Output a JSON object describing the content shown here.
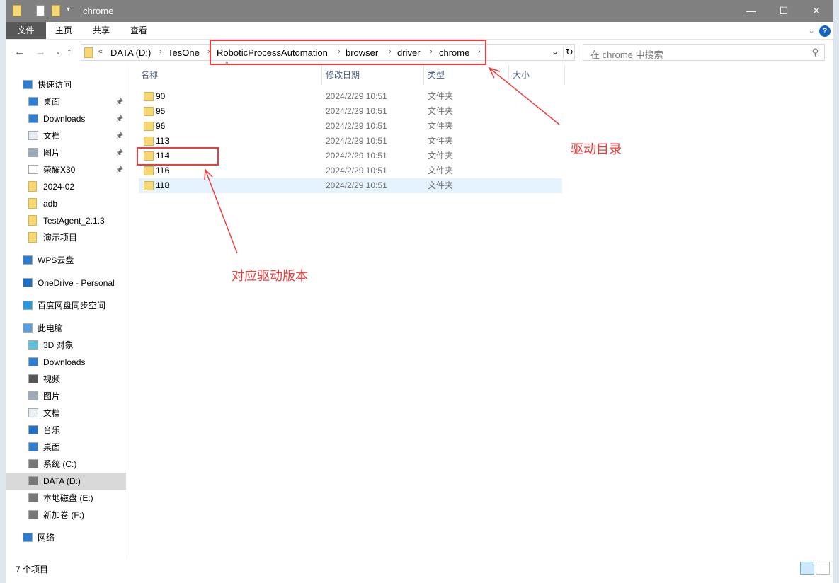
{
  "window": {
    "title": "chrome",
    "minimize": "—",
    "maximize": "☐",
    "close": "✕"
  },
  "ribbon": {
    "tabs": [
      "文件",
      "主页",
      "共享",
      "查看"
    ],
    "help": "?"
  },
  "address": {
    "overflow": "«",
    "crumbs": [
      "DATA (D:)",
      "TesOne",
      "RoboticProcessAutomation",
      "browser",
      "driver",
      "chrome"
    ],
    "sep": "›"
  },
  "search": {
    "placeholder": "在 chrome 中搜索"
  },
  "sidebar": {
    "items": [
      {
        "label": "快速访问",
        "icon": "star-icon"
      },
      {
        "label": "桌面",
        "icon": "desktop-icon",
        "pinned": true
      },
      {
        "label": "Downloads",
        "icon": "download-icon",
        "pinned": true
      },
      {
        "label": "文档",
        "icon": "document-icon",
        "pinned": true
      },
      {
        "label": "图片",
        "icon": "picture-icon",
        "pinned": true
      },
      {
        "label": "荣耀X30",
        "icon": "file-icon",
        "pinned": true
      },
      {
        "label": "2024-02",
        "icon": "folder-icon"
      },
      {
        "label": "adb",
        "icon": "folder-icon"
      },
      {
        "label": "TestAgent_2.1.3",
        "icon": "folder-icon"
      },
      {
        "label": "演示项目",
        "icon": "folder-icon"
      },
      {
        "label": "WPS云盘",
        "icon": "cloud-icon"
      },
      {
        "label": "OneDrive - Personal",
        "icon": "onedrive-icon"
      },
      {
        "label": "百度网盘同步空间",
        "icon": "baidu-icon"
      },
      {
        "label": "此电脑",
        "icon": "computer-icon"
      },
      {
        "label": "3D 对象",
        "icon": "3d-icon"
      },
      {
        "label": "Downloads",
        "icon": "download-icon"
      },
      {
        "label": "视频",
        "icon": "video-icon"
      },
      {
        "label": "图片",
        "icon": "picture-icon"
      },
      {
        "label": "文档",
        "icon": "document-icon"
      },
      {
        "label": "音乐",
        "icon": "music-icon"
      },
      {
        "label": "桌面",
        "icon": "desktop-icon"
      },
      {
        "label": "系统 (C:)",
        "icon": "drive-icon"
      },
      {
        "label": "DATA (D:)",
        "icon": "drive-icon",
        "selected": true
      },
      {
        "label": "本地磁盘 (E:)",
        "icon": "drive-icon"
      },
      {
        "label": "新加卷 (F:)",
        "icon": "drive-icon"
      },
      {
        "label": "网络",
        "icon": "network-icon"
      }
    ]
  },
  "columns": [
    "名称",
    "修改日期",
    "类型",
    "大小"
  ],
  "files": [
    {
      "name": "90",
      "date": "2024/2/29 10:51",
      "type": "文件夹"
    },
    {
      "name": "95",
      "date": "2024/2/29 10:51",
      "type": "文件夹"
    },
    {
      "name": "96",
      "date": "2024/2/29 10:51",
      "type": "文件夹"
    },
    {
      "name": "113",
      "date": "2024/2/29 10:51",
      "type": "文件夹"
    },
    {
      "name": "114",
      "date": "2024/2/29 10:51",
      "type": "文件夹"
    },
    {
      "name": "116",
      "date": "2024/2/29 10:51",
      "type": "文件夹"
    },
    {
      "name": "118",
      "date": "2024/2/29 10:51",
      "type": "文件夹"
    }
  ],
  "annotations": {
    "driver_dir": "驱动目录",
    "driver_version": "对应驱动版本"
  },
  "status": {
    "count": "7 个项目"
  },
  "colors": {
    "annotation": "#f03c3c",
    "titlebar": "#808080"
  }
}
